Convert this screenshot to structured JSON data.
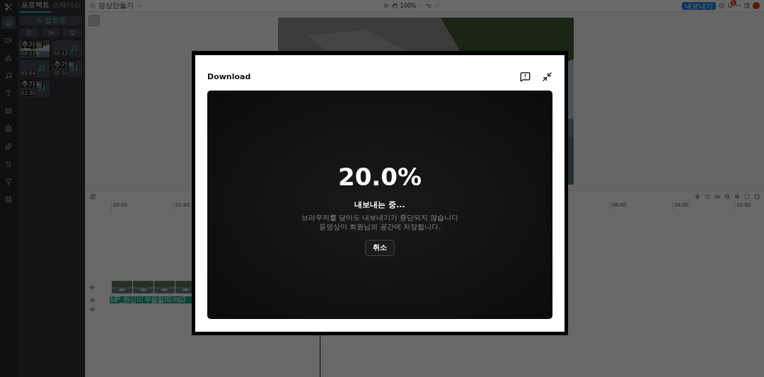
{
  "rail": {
    "items": [
      {
        "selected": true
      },
      {
        "selected": false
      },
      {
        "selected": false
      },
      {
        "selected": false
      },
      {
        "selected": false
      },
      {
        "selected": false
      },
      {
        "selected": false
      },
      {
        "selected": false
      },
      {
        "selected": false
      },
      {
        "selected": false
      },
      {
        "selected": false
      }
    ]
  },
  "media_panel": {
    "tabs": [
      {
        "label": "프로젝트",
        "selected": true
      },
      {
        "label": "스페이스",
        "selected": false
      }
    ],
    "upload_button": "업로드",
    "clips": [
      {
        "kind": "video",
        "badge": "추가됨",
        "duration": "00:22"
      },
      {
        "kind": "audio",
        "duration": "02:12"
      },
      {
        "kind": "audio",
        "duration": "02:04"
      },
      {
        "kind": "audio",
        "badge": "추가됨",
        "duration": "02:30"
      },
      {
        "kind": "audio",
        "badge": "추가됨",
        "duration": "02:30"
      }
    ]
  },
  "topbar": {
    "project_title": "영상만들기",
    "zoom": "100%",
    "export_button": "내보내기",
    "notification_count": "1"
  },
  "timeline": {
    "left_ticks": [
      "00:00",
      "01:00"
    ],
    "right_ticks": [
      "08:00",
      "09:00",
      "10:00"
    ],
    "audio_clip": "MP_한강이 우울할 때.mp3"
  },
  "modal": {
    "title": "Download",
    "percent": "20.0%",
    "status": "내보내는 중...",
    "message_lines": [
      "브라우저를 닫아도 내보내기가 중단되지 않습니다",
      "동영상이 회원님의 공간에 저장됩니다."
    ],
    "cancel_button": "취소"
  }
}
